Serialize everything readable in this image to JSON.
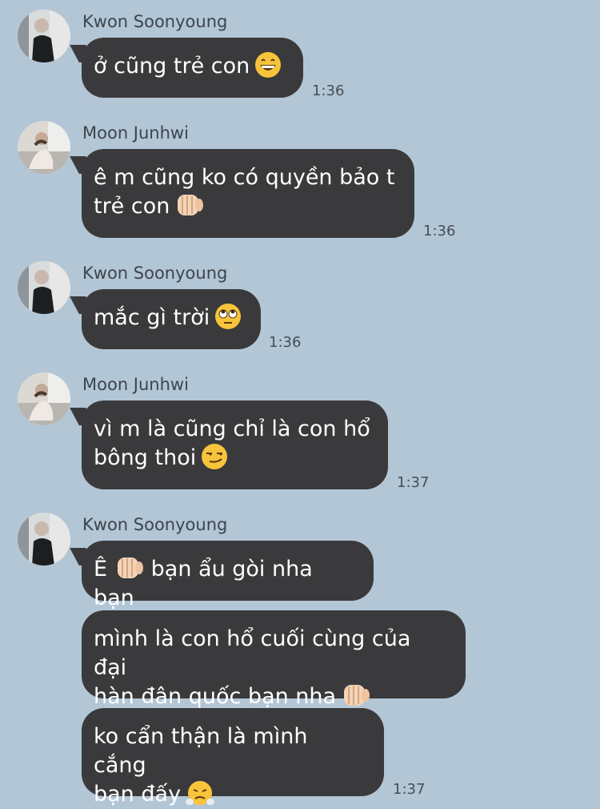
{
  "chat": {
    "messages": [
      {
        "sender": "Kwon Soonyoung",
        "text": "ở cũng trẻ con",
        "emoji": "grinning-face-icon",
        "time": "1:36"
      },
      {
        "sender": "Moon Junhwi",
        "text": "ê m cũng ko có quyền bảo t\ntrẻ con",
        "emoji": "fist-icon",
        "time": "1:36"
      },
      {
        "sender": "Kwon Soonyoung",
        "text": "mắc gì trời",
        "emoji": "eye-roll-face-icon",
        "time": "1:36"
      },
      {
        "sender": "Moon Junhwi",
        "text": "vì m là cũng chỉ là con hổ\nbông thoi",
        "emoji": "smirk-face-icon",
        "time": "1:37"
      },
      {
        "sender": "Kwon Soonyoung",
        "text_prefix": "Ê",
        "text": "bạn ẩu gòi nha bạn",
        "emoji": "fist-icon"
      },
      {
        "text": "mình là con hổ cuối cùng của đại\nhàn đân quốc bạn nha",
        "emoji": "fist-icon"
      },
      {
        "text": "ko cẩn thận là mình cắng\nbạn đấy",
        "emoji": "steam-nose-face-icon",
        "time": "1:37"
      }
    ]
  }
}
